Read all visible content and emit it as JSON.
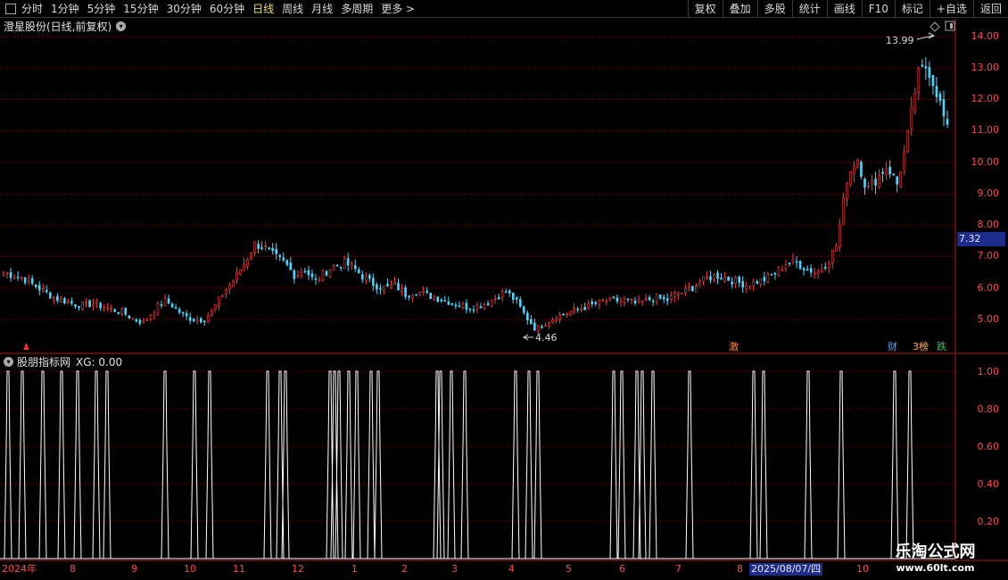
{
  "toolbar": {
    "periods": [
      "分时",
      "1分钟",
      "5分钟",
      "15分钟",
      "30分钟",
      "60分钟",
      "日线",
      "周线",
      "月线",
      "多周期",
      "更多 >"
    ],
    "active_period": "日线",
    "actions": [
      "复权",
      "叠加",
      "多股",
      "统计",
      "画线",
      "F10",
      "标记",
      "+自选",
      "返回"
    ]
  },
  "main_chart": {
    "title": "澄星股份(日线,前复权)",
    "price_axis": [
      "14.00",
      "13.00",
      "12.00",
      "11.00",
      "10.00",
      "9.00",
      "8.00",
      "7.00",
      "6.00",
      "5.00"
    ],
    "current_price": "7.32",
    "high_label": "13.99",
    "low_label": "4.46"
  },
  "events": {
    "ji": "激",
    "cai": "财",
    "bang": "3榜",
    "die": "跌"
  },
  "indicator": {
    "title": "股朋指标网",
    "value_text": "XG: 0.00",
    "axis": [
      "1.00",
      "0.80",
      "0.60",
      "0.40",
      "0.20"
    ]
  },
  "date_axis": {
    "labels": [
      "2024年",
      "8",
      "9",
      "10",
      "11",
      "12",
      "1",
      "2",
      "3",
      "4",
      "5",
      "6",
      "7",
      "8",
      "10"
    ],
    "highlight": "2025/08/07/四"
  },
  "watermark": {
    "title": "乐淘公式网",
    "url": "www.60lt.com"
  },
  "colors": {
    "up": "#ff3c3c",
    "down": "#4ad8ff",
    "grid": "#8b0000",
    "signal": "#ffffff"
  },
  "chart_data": {
    "type": "candlestick",
    "price_range": [
      4.1,
      14.6
    ],
    "close": [
      6.5,
      6.4,
      6.3,
      6.1,
      5.9,
      5.7,
      5.6,
      5.5,
      5.45,
      5.5,
      5.4,
      5.3,
      5.2,
      5.0,
      4.9,
      5.3,
      5.6,
      5.4,
      5.1,
      5.0,
      5.0,
      5.4,
      5.9,
      6.3,
      6.8,
      7.4,
      7.3,
      7.0,
      6.8,
      6.4,
      6.6,
      6.2,
      6.5,
      6.7,
      6.8,
      6.6,
      6.3,
      6.1,
      6.0,
      6.1,
      5.8,
      5.9,
      5.8,
      5.7,
      5.6,
      5.5,
      5.4,
      5.4,
      5.5,
      5.7,
      5.9,
      5.6,
      5.1,
      4.7,
      4.9,
      5.1,
      5.2,
      5.3,
      5.4,
      5.5,
      5.6,
      5.6,
      5.6,
      5.5,
      5.6,
      5.7,
      5.6,
      5.8,
      5.9,
      6.1,
      6.3,
      6.4,
      6.3,
      6.2,
      6.1,
      6.2,
      6.3,
      6.5,
      6.8,
      6.8,
      6.6,
      6.5,
      6.8,
      7.4,
      9.5,
      10.2,
      9.1,
      9.5,
      9.9,
      9.3,
      10.7,
      12.7,
      13.1,
      12.2,
      11.0
    ]
  }
}
